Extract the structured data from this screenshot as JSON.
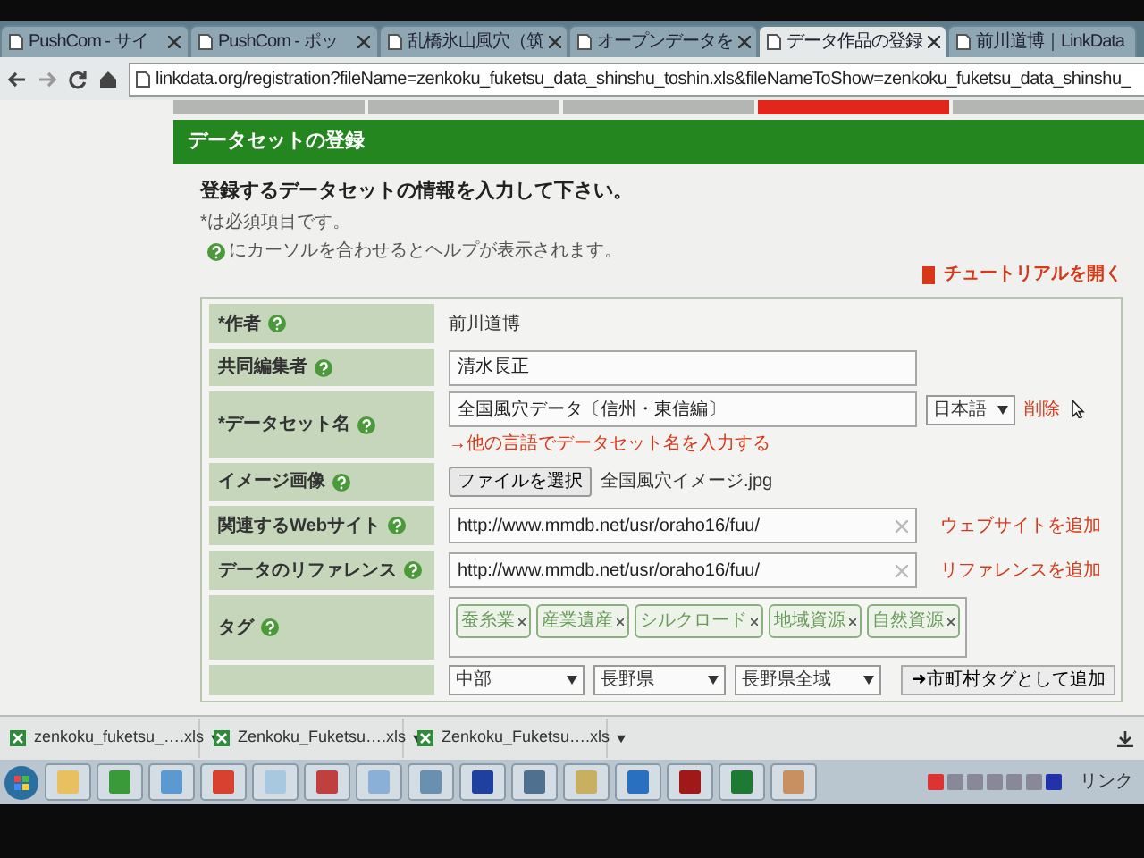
{
  "browser": {
    "tabs": [
      {
        "label": "PushCom - サイ",
        "selected": false
      },
      {
        "label": "PushCom - ポッ",
        "selected": false
      },
      {
        "label": "乱橋氷山風穴（筑",
        "selected": false
      },
      {
        "label": "オープンデータを",
        "selected": false
      },
      {
        "label": "データ作品の登録",
        "selected": true
      },
      {
        "label": "前川道博｜LinkData",
        "selected": false
      }
    ],
    "url": "linkdata.org/registration?fileName=zenkoku_fuketsu_data_shinshu_toshin.xls&fileNameToShow=zenkoku_fuketsu_data_shinshu_"
  },
  "steps": [
    {
      "selected": false
    },
    {
      "selected": false
    },
    {
      "selected": false
    },
    {
      "selected": true
    },
    {
      "selected": false
    }
  ],
  "page": {
    "header": "データセットの登録",
    "intro": "登録するデータセットの情報を入力して下さい。",
    "required_note": "*は必須項目です。",
    "help_note": "にカーソルを合わせるとヘルプが表示されます。",
    "tutorial_link": "チュートリアルを開く"
  },
  "form": [
    {
      "kind": "static",
      "label": "*作者",
      "value": "前川道博"
    },
    {
      "kind": "input",
      "label": "共同編集者",
      "value": "清水長正"
    },
    {
      "kind": "name",
      "label": "*データセット名",
      "value": "全国風穴データ〔信州・東信編〕",
      "language": "日本語",
      "delete": "削除",
      "other_language_link": "→他の言語でデータセット名を入力する"
    },
    {
      "kind": "file",
      "label": "イメージ画像",
      "button": "ファイルを選択",
      "file_name": "全国風穴イメージ.jpg"
    },
    {
      "kind": "url",
      "label": "関連するWebサイト",
      "value": "http://www.mmdb.net/usr/oraho16/fuu/",
      "action": "ウェブサイトを追加"
    },
    {
      "kind": "url",
      "label": "データのリファレンス",
      "value": "http://www.mmdb.net/usr/oraho16/fuu/",
      "action": "リファレンスを追加"
    },
    {
      "kind": "tags",
      "label": "タグ",
      "tags": [
        "蚕糸業",
        "産業遺産",
        "シルクロード",
        "地域資源",
        "自然資源"
      ]
    },
    {
      "kind": "region",
      "selects": [
        "中部",
        "長野県",
        "長野県全域"
      ],
      "button": "➜市町村タグとして追加"
    }
  ],
  "downloads": [
    "zenkoku_fuketsu_….xls",
    "Zenkoku_Fuketsu….xls",
    "Zenkoku_Fuketsu….xls"
  ],
  "taskbar": {
    "tray_label": "リンク"
  }
}
